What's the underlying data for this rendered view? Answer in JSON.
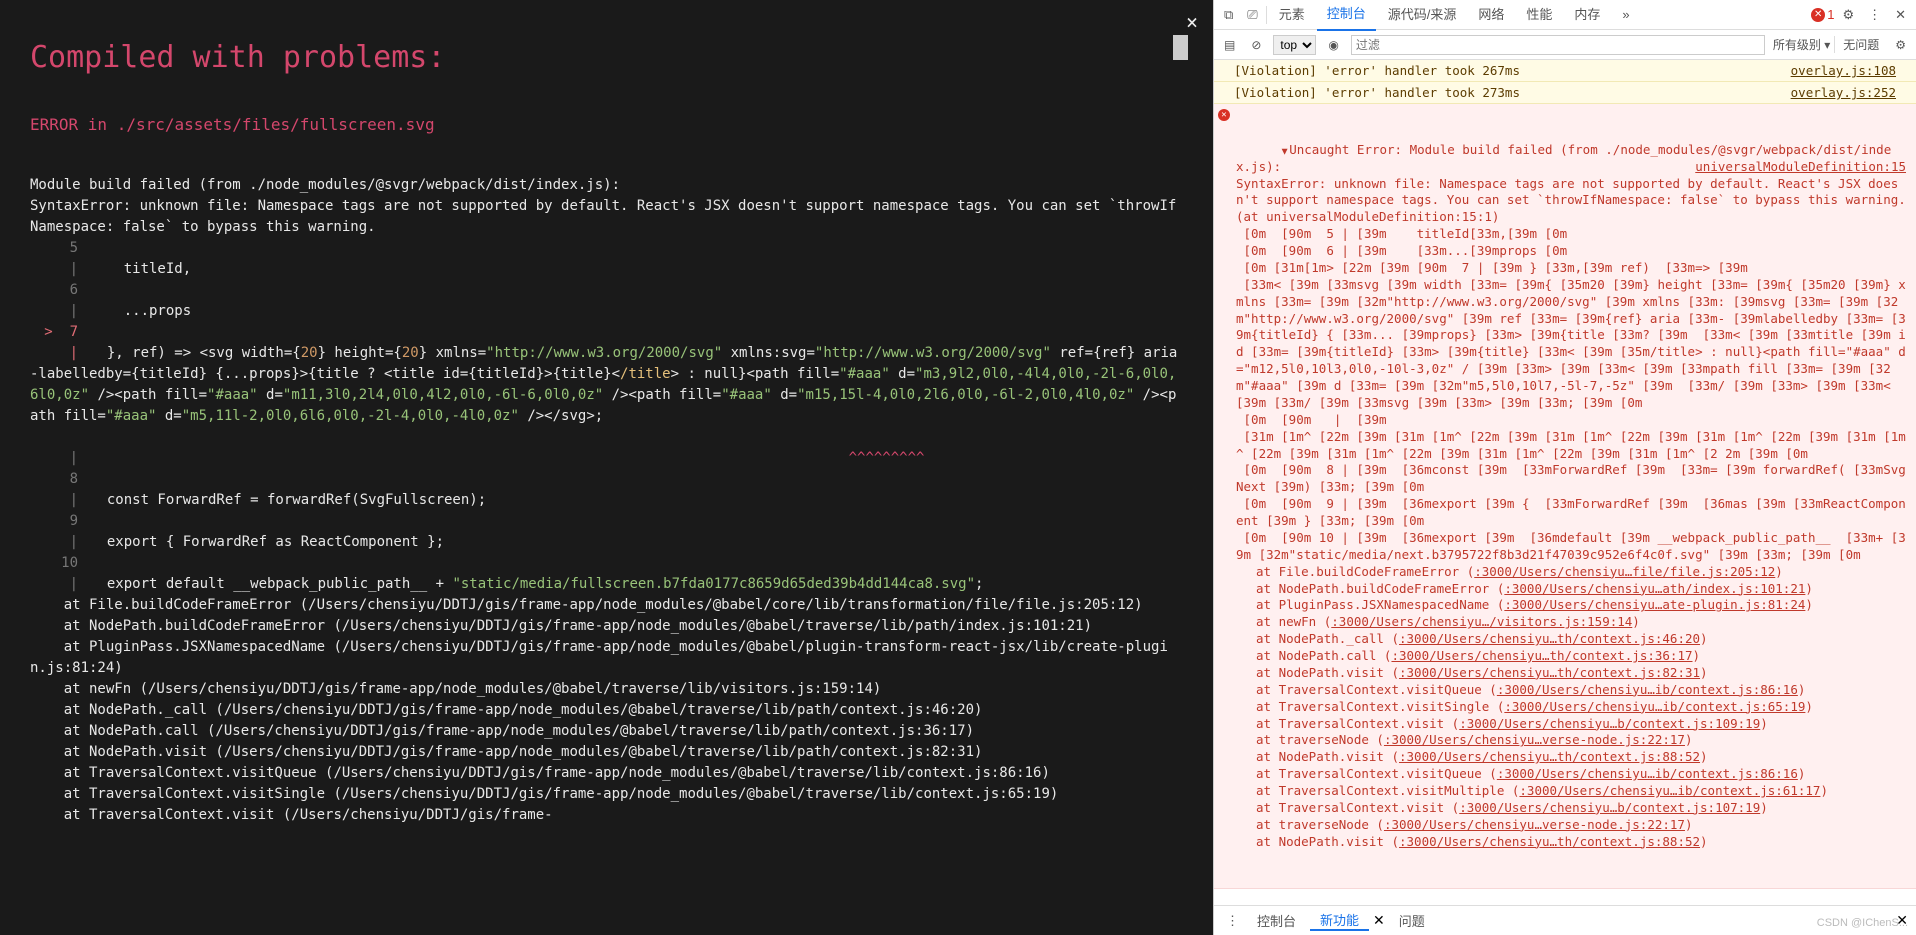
{
  "overlay": {
    "title": "Compiled with problems:",
    "close": "×",
    "error_heading": "ERROR in ./src/assets/files/fullscreen.svg",
    "msg1": "Module build failed (from ./node_modules/@svgr/webpack/dist/index.js):",
    "msg2": "SyntaxError: unknown file: Namespace tags are not supported by default. React's JSX doesn't support namespace tags. You can set `throwIfNamespace: false` to bypass this warning.",
    "line5_g": "   5 |",
    "line5_t": "    titleId,",
    "line6_g": "   6 |",
    "line6_t": "    ...props",
    "line7_pre": ">  7 |",
    "line7_a": "  }, ref) => <svg width={",
    "line7_20a": "20",
    "line7_b": "} height={",
    "line7_20b": "20",
    "line7_c": "} xmlns=",
    "line7_url1": "\"http://www.w3.org/2000/svg\"",
    "line7_d": " xmlns:svg=",
    "line7_url2": "\"http://www.w3.org/2000/svg\"",
    "line7_e": " ref={ref} aria-labelledby={titleId} {...props}>{title ? <title id={titleId}>{title}<",
    "line7_f": "/title",
    "line7_g2": "> : null}<path fill=",
    "line7_fill1": "\"#aaa\"",
    "line7_h": " d=",
    "line7_d1": "\"m3,9l2,0l0,-4l4,0l0,-2l-6,0l0,6l0,0z\"",
    "line7_i": " /><path fill=",
    "line7_fill2": "\"#aaa\"",
    "line7_j": " d=",
    "line7_d2": "\"m11,3l0,2l4,0l0,4l2,0l0,-6l-6,0l0,0z\"",
    "line7_k": " /><path fill=",
    "line7_fill3": "\"#aaa\"",
    "line7_l": " d=",
    "line7_d3": "\"m15,15l-4,0l0,2l6,0l0,-6l-2,0l0,4l0,0z\"",
    "line7_m": " /><path fill=",
    "line7_fill4": "\"#aaa\"",
    "line7_n": " d=",
    "line7_d4": "\"m5,11l-2,0l0,6l6,0l0,-2l-4,0l0,-4l0,0z\"",
    "line7_o": " /></svg>;",
    "caret_g": "     |",
    "caret": "                                                                                          ^^^^^^^^^",
    "line8_g": "   8 |",
    "line8_t": "  const ForwardRef = forwardRef(SvgFullscreen);",
    "line9_g": "   9 |",
    "line9_t": "  export { ForwardRef as ReactComponent };",
    "line10_g": "  10 |",
    "line10_a": "  export default __webpack_public_path__ + ",
    "line10_b": "\"static/media/fullscreen.b7fda0177c8659d65ded39b4dd144ca8.svg\"",
    "line10_c": ";",
    "stack": [
      "    at File.buildCodeFrameError (/Users/chensiyu/DDTJ/gis/frame-app/node_modules/@babel/core/lib/transformation/file/file.js:205:12)",
      "    at NodePath.buildCodeFrameError (/Users/chensiyu/DDTJ/gis/frame-app/node_modules/@babel/traverse/lib/path/index.js:101:21)",
      "    at PluginPass.JSXNamespacedName (/Users/chensiyu/DDTJ/gis/frame-app/node_modules/@babel/plugin-transform-react-jsx/lib/create-plugin.js:81:24)",
      "    at newFn (/Users/chensiyu/DDTJ/gis/frame-app/node_modules/@babel/traverse/lib/visitors.js:159:14)",
      "    at NodePath._call (/Users/chensiyu/DDTJ/gis/frame-app/node_modules/@babel/traverse/lib/path/context.js:46:20)",
      "    at NodePath.call (/Users/chensiyu/DDTJ/gis/frame-app/node_modules/@babel/traverse/lib/path/context.js:36:17)",
      "    at NodePath.visit (/Users/chensiyu/DDTJ/gis/frame-app/node_modules/@babel/traverse/lib/path/context.js:82:31)",
      "    at TraversalContext.visitQueue (/Users/chensiyu/DDTJ/gis/frame-app/node_modules/@babel/traverse/lib/context.js:86:16)",
      "    at TraversalContext.visitSingle (/Users/chensiyu/DDTJ/gis/frame-app/node_modules/@babel/traverse/lib/context.js:65:19)",
      "    at TraversalContext.visit (/Users/chensiyu/DDTJ/gis/frame-"
    ]
  },
  "devtools": {
    "tabs": [
      "元素",
      "控制台",
      "源代码/来源",
      "网络",
      "性能",
      "内存"
    ],
    "more": "»",
    "errCount": "1",
    "top": "top",
    "filter_ph": "过滤",
    "levels": "所有级别",
    "issues": "无问题",
    "violations": [
      {
        "text": "[Violation] 'error' handler took 267ms",
        "src": "overlay.js:108"
      },
      {
        "text": "[Violation] 'error' handler took 273ms",
        "src": "overlay.js:252"
      }
    ],
    "errTop": "Uncaught Error: Module build failed (from ./node_modules/@svgr/webpack/dist/index.js):",
    "errTopSrc": "universalModuleDefinition:15",
    "errBody": "SyntaxError: unknown file: Namespace tags are not supported by default. React's JSX doesn't support namespace tags. You can set `throwIfNamespace: false` to bypass this warning. (at universalModuleDefinition:15:1)\n [0m  [90m  5 | [39m    titleId[33m,[39m [0m\n [0m  [90m  6 | [39m    [33m...[39mprops [0m\n [0m [31m[1m> [22m [39m [90m  7 | [39m } [33m,[39m ref)  [33m=> [39m\n [33m< [39m [33msvg [39m width [33m= [39m{ [35m20 [39m} height [33m= [39m{ [35m20 [39m} xmlns [33m= [39m [32m\"http://www.w3.org/2000/svg\" [39m xmlns [33m: [39msvg [33m= [39m [32m\"http://www.w3.org/2000/svg\" [39m ref [33m= [39m{ref} aria [33m- [39mlabelledby [33m= [39m{titleId} { [33m... [39mprops} [33m> [39m{title [33m? [39m  [33m< [39m [33mtitle [39m id [33m= [39m{titleId} [33m> [39m{title} [33m< [39m [35m/title> : null}<path fill=\"#aaa\" d=\"m12,5l0,10l3,0l0,-10l-3,0z\" / [39m [33m> [39m [33m< [39m [33mpath fill [33m= [39m [32m\"#aaa\" [39m d [33m= [39m [32m\"m5,5l0,10l7,-5l-7,-5z\" [39m  [33m/ [39m [33m> [39m [33m< [39m [33m/ [39m [33msvg [39m [33m> [39m [33m; [39m [0m\n [0m  [90m   |  [39m\n [31m [1m^ [22m [39m [31m [1m^ [22m [39m [31m [1m^ [22m [39m [31m [1m^ [22m [39m [31m [1m^ [22m [39m [31m [1m^ [22m [39m [31m [1m^ [22m [39m [31m [1m^ [2 2m [39m [0m\n [0m  [90m  8 | [39m  [36mconst [39m  [33mForwardRef [39m  [33m= [39m forwardRef( [33mSvgNext [39m) [33m; [39m [0m\n [0m  [90m  9 | [39m  [36mexport [39m {  [33mForwardRef [39m  [36mas [39m [33mReactComponent [39m } [33m; [39m [0m\n [0m  [90m 10 | [39m  [36mexport [39m  [36mdefault [39m __webpack_public_path__  [33m+ [39m [32m\"static/media/next.b3795722f8b3d21f47039c952e6f4c0f.svg\" [39m [33m; [39m [0m",
    "stack": [
      {
        "t": "at File.buildCodeFrameError (",
        "l": ":3000/Users/chensiyu…file/file.js:205:12"
      },
      {
        "t": "at NodePath.buildCodeFrameError (",
        "l": ":3000/Users/chensiyu…ath/index.js:101:21"
      },
      {
        "t": "at PluginPass.JSXNamespacedName (",
        "l": ":3000/Users/chensiyu…ate-plugin.js:81:24"
      },
      {
        "t": "at newFn (",
        "l": ":3000/Users/chensiyu…/visitors.js:159:14"
      },
      {
        "t": "at NodePath._call (",
        "l": ":3000/Users/chensiyu…th/context.js:46:20"
      },
      {
        "t": "at NodePath.call (",
        "l": ":3000/Users/chensiyu…th/context.js:36:17"
      },
      {
        "t": "at NodePath.visit (",
        "l": ":3000/Users/chensiyu…th/context.js:82:31"
      },
      {
        "t": "at TraversalContext.visitQueue (",
        "l": ":3000/Users/chensiyu…ib/context.js:86:16"
      },
      {
        "t": "at TraversalContext.visitSingle (",
        "l": ":3000/Users/chensiyu…ib/context.js:65:19"
      },
      {
        "t": "at TraversalContext.visit (",
        "l": ":3000/Users/chensiyu…b/context.js:109:19"
      },
      {
        "t": "at traverseNode (",
        "l": ":3000/Users/chensiyu…verse-node.js:22:17"
      },
      {
        "t": "at NodePath.visit (",
        "l": ":3000/Users/chensiyu…th/context.js:88:52"
      },
      {
        "t": "at TraversalContext.visitQueue (",
        "l": ":3000/Users/chensiyu…ib/context.js:86:16"
      },
      {
        "t": "at TraversalContext.visitMultiple (",
        "l": ":3000/Users/chensiyu…ib/context.js:61:17"
      },
      {
        "t": "at TraversalContext.visit (",
        "l": ":3000/Users/chensiyu…b/context.js:107:19"
      },
      {
        "t": "at traverseNode (",
        "l": ":3000/Users/chensiyu…verse-node.js:22:17"
      },
      {
        "t": "at NodePath.visit (",
        "l": ":3000/Users/chensiyu…th/context.js:88:52"
      }
    ],
    "bottom": [
      "控制台",
      "新功能",
      "问题"
    ],
    "watermark": "CSDN @IChenS..."
  }
}
